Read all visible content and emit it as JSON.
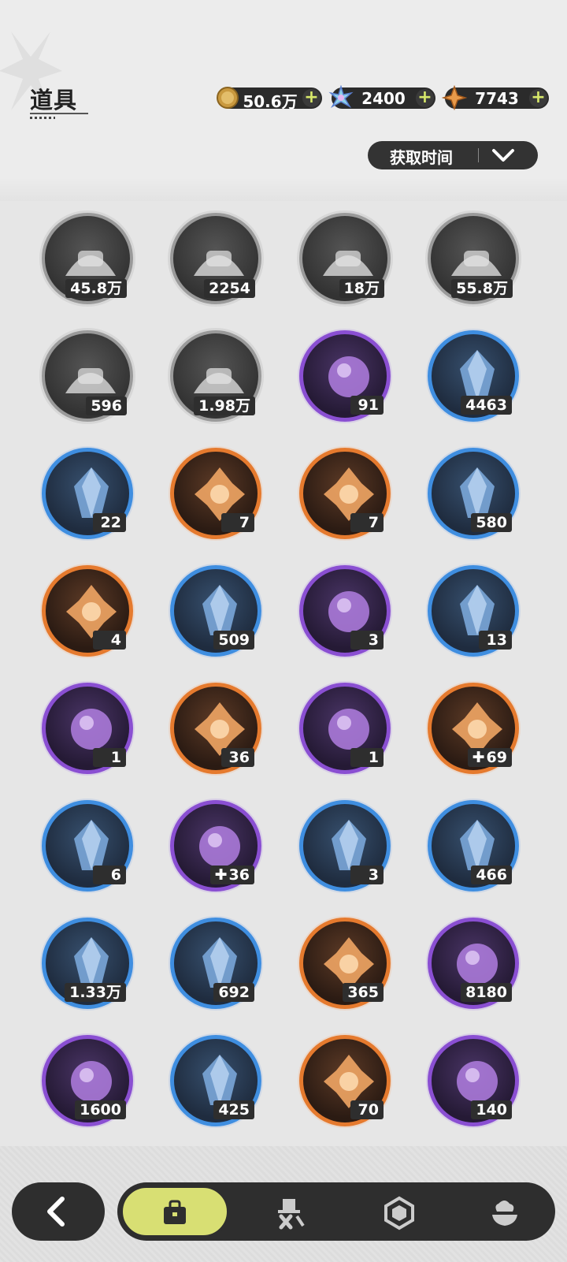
{
  "header": {
    "title": "道具",
    "sort_label": "获取时间"
  },
  "currencies": [
    {
      "value": "50.6万",
      "icon": "gold-coin-icon",
      "color": "#d8a94a"
    },
    {
      "value": "2400",
      "icon": "crystal-flower-icon",
      "color": "#8fd3e8"
    },
    {
      "value": "7743",
      "icon": "star-shard-icon",
      "color": "#e89a4a"
    }
  ],
  "items": [
    {
      "qty": "45.8万",
      "rarity": "grey",
      "icon": "sand-pile-icon"
    },
    {
      "qty": "2254",
      "rarity": "grey",
      "icon": "feed-sack-icon"
    },
    {
      "qty": "18万",
      "rarity": "grey",
      "icon": "purple-orb-icon"
    },
    {
      "qty": "55.8万",
      "rarity": "grey",
      "icon": "ore-crystal-icon"
    },
    {
      "qty": "596",
      "rarity": "grey",
      "icon": "stone-bricks-icon"
    },
    {
      "qty": "1.98万",
      "rarity": "grey",
      "icon": "wood-logs-icon"
    },
    {
      "qty": "91",
      "rarity": "purple",
      "icon": "heart-coin-icon"
    },
    {
      "qty": "4463",
      "rarity": "blue",
      "icon": "red-crystal-icon"
    },
    {
      "qty": "22",
      "rarity": "blue",
      "icon": "blue-card-icon"
    },
    {
      "qty": "7",
      "rarity": "orange",
      "icon": "gold-card-icon"
    },
    {
      "qty": "7",
      "rarity": "orange",
      "icon": "rainbow-ticket-icon"
    },
    {
      "qty": "580",
      "rarity": "blue",
      "icon": "shovel-icon"
    },
    {
      "qty": "4",
      "rarity": "orange",
      "icon": "paw-charm-icon"
    },
    {
      "qty": "509",
      "rarity": "blue",
      "icon": "hammer-icon"
    },
    {
      "qty": "3",
      "rarity": "purple",
      "icon": "purple-card-icon"
    },
    {
      "qty": "13",
      "rarity": "blue",
      "icon": "broom-icon"
    },
    {
      "qty": "1",
      "rarity": "purple",
      "icon": "potion-bottle-icon"
    },
    {
      "qty": "36",
      "rarity": "orange",
      "icon": "crystal-fruit-icon"
    },
    {
      "qty": "1",
      "rarity": "purple",
      "icon": "fiber-bundle-icon"
    },
    {
      "qty": "69",
      "rarity": "orange",
      "icon": "plush-bear-icon",
      "puzzle": true
    },
    {
      "qty": "6",
      "rarity": "blue",
      "icon": "vial-icon"
    },
    {
      "qty": "36",
      "rarity": "purple",
      "icon": "frog-plush-icon",
      "puzzle": true
    },
    {
      "qty": "3",
      "rarity": "blue",
      "icon": "photo-card-icon"
    },
    {
      "qty": "466",
      "rarity": "blue",
      "icon": "boxing-glove-icon"
    },
    {
      "qty": "1.33万",
      "rarity": "blue",
      "icon": "gold-sand-icon"
    },
    {
      "qty": "692",
      "rarity": "blue",
      "icon": "scale-shield-icon"
    },
    {
      "qty": "365",
      "rarity": "orange",
      "icon": "ice-crystal-icon"
    },
    {
      "qty": "8180",
      "rarity": "purple",
      "icon": "teal-coin-icon"
    },
    {
      "qty": "1600",
      "rarity": "purple",
      "icon": "fist-coin-icon"
    },
    {
      "qty": "425",
      "rarity": "blue",
      "icon": "pickaxe-icon"
    },
    {
      "qty": "70",
      "rarity": "orange",
      "icon": "pink-crystal-icon"
    },
    {
      "qty": "140",
      "rarity": "purple",
      "icon": "silver-coin-icon"
    }
  ],
  "nav": {
    "back": "back-arrow-icon",
    "tabs": [
      "bag-icon",
      "hat-tools-icon",
      "hexagon-gem-icon",
      "dessert-icon"
    ],
    "active_tab": 0,
    "active_color": "#d8df73"
  }
}
